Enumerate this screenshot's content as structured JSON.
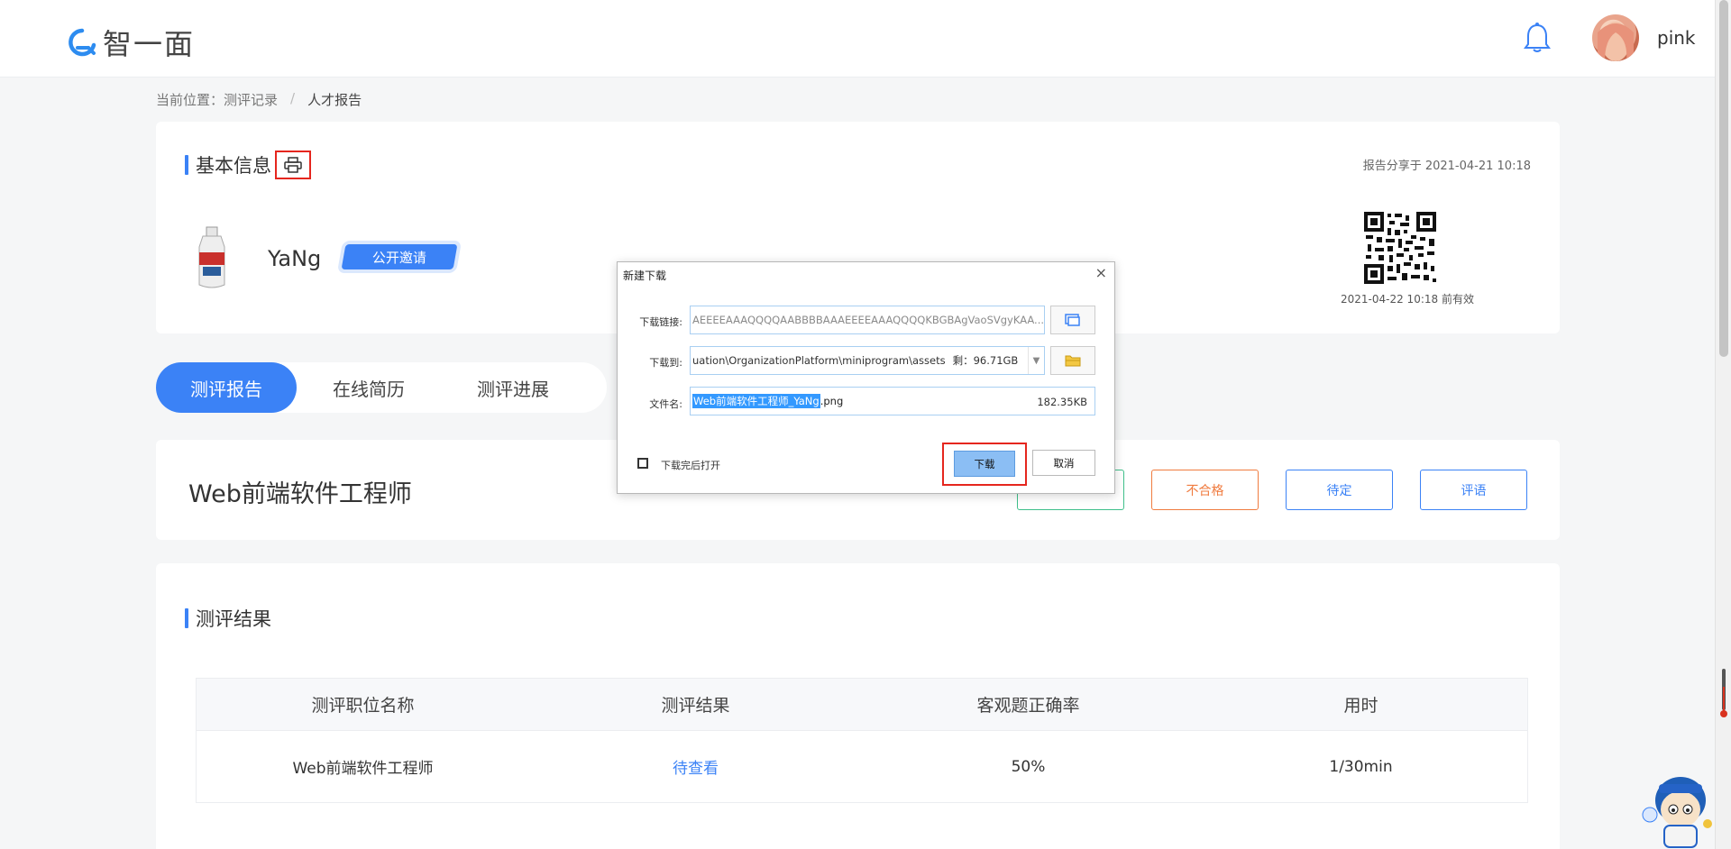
{
  "header": {
    "logo_text": "智一面",
    "user_name": "pink"
  },
  "breadcrumb": {
    "prefix": "当前位置：",
    "items": [
      "测评记录",
      "人才报告"
    ],
    "separator": "/"
  },
  "basic_info": {
    "title": "基本信息",
    "share_time": "报告分享于 2021-04-21 10:18",
    "candidate_name": "YaNg",
    "tag": "公开邀请",
    "qr_valid": "2021-04-22 10:18 前有效"
  },
  "tabs": [
    {
      "label": "测评报告",
      "active": true
    },
    {
      "label": "在线简历",
      "active": false
    },
    {
      "label": "测评进展",
      "active": false
    }
  ],
  "job": {
    "title": "Web前端软件工程师",
    "actions": [
      "不合格",
      "待定",
      "评语"
    ],
    "colors": {
      "reject": "#f07b3f",
      "pending": "#3b82f6",
      "comment": "#3b82f6",
      "pass": "#3fbf8a"
    }
  },
  "result": {
    "title": "测评结果",
    "columns": [
      "测评职位名称",
      "测评结果",
      "客观题正确率",
      "用时"
    ],
    "rows": [
      [
        "Web前端软件工程师",
        "待查看",
        "50%",
        "1/30min"
      ]
    ]
  },
  "dialog": {
    "title": "新建下载",
    "url_label": "下载链接:",
    "url_value": "AEEEEAAAQQQQAABBBBAAAEEEEAAAQQQQKBGBAgVaoSVgyKAA...",
    "dest_label": "下载到:",
    "dest_value": "uation\\OrganizationPlatform\\miniprogram\\assets",
    "free_space": "剩：96.71GB",
    "filename_label": "文件名:",
    "filename_selected": "Web前端软件工程师_YaNg",
    "filename_ext": ".png",
    "file_size": "182.35KB",
    "open_after_label": "下载完后打开",
    "download_label": "下载",
    "cancel_label": "取消"
  }
}
